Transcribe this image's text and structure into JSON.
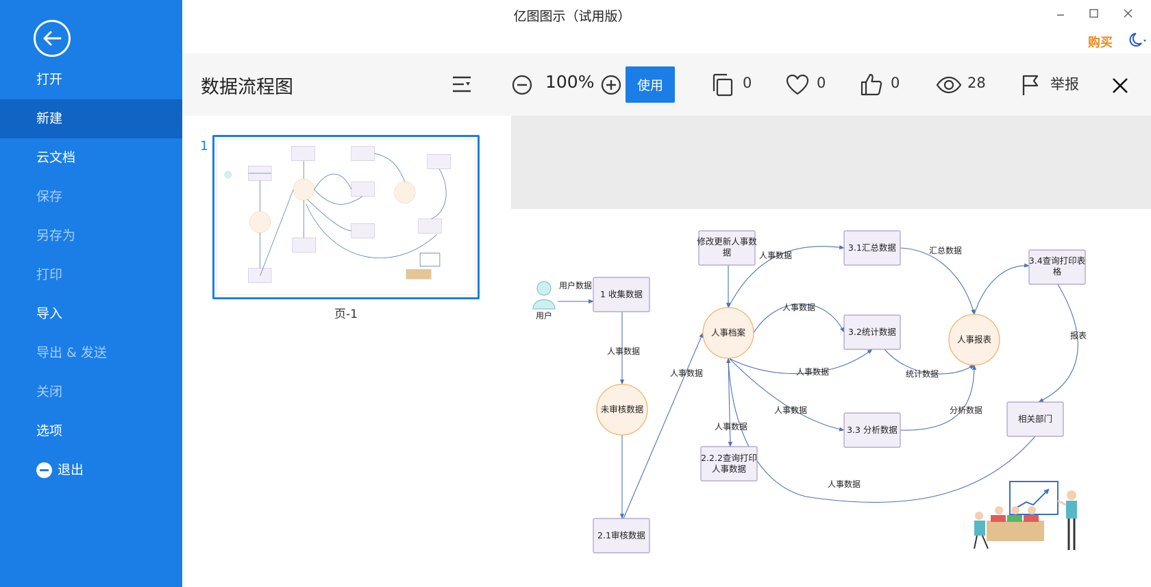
{
  "sidebar": {
    "menu": [
      "打开",
      "新建",
      "云文档",
      "保存",
      "另存为",
      "打印",
      "导入",
      "导出 & 发送",
      "关闭",
      "选项",
      "退出"
    ],
    "active": "新建"
  },
  "window": {
    "title": "亿图图示（试用版）",
    "buy": "购买"
  },
  "toolbar": {
    "doc_title": "数据流程图",
    "zoom": "100%",
    "use_label": "使用",
    "copies": "0",
    "likes": "0",
    "thumbs_up": "0",
    "views": "28",
    "report_label": "举报"
  },
  "pages": {
    "index": "1",
    "label": "页-1"
  },
  "diagram": {
    "user_actor": "用户",
    "nodes": {
      "collect": "1 收集数据",
      "unreviewed": "未审核数据",
      "reviewed": "2.1审核数据",
      "archive": "人事档案",
      "modify_line1": "修改更新人事数",
      "modify_line2": "据",
      "print_hr_line1": "2.2.2查询打印",
      "print_hr_line2": "人事数据",
      "summary": "3.1汇总数据",
      "statistics": "3.2统计数据",
      "analysis": "3.3 分析数据",
      "report": "人事报表",
      "print_table_line1": "3.4查询打印表",
      "print_table_line2": "格",
      "dept": "相关部门"
    },
    "edges": {
      "user_data": "用户数据",
      "hr_data": "人事数据",
      "summary_data": "汇总数据",
      "stat_data": "统计数据",
      "analysis_data": "分析数据",
      "report_label": "报表"
    }
  },
  "colors": {
    "accent": "#1a7ee6",
    "sidebar_active": "#0f64c4",
    "buy": "#f08a1a",
    "edge": "#4e72b5",
    "box_fill": "#f2eef8",
    "circle_fill": "#fdf0e4"
  }
}
